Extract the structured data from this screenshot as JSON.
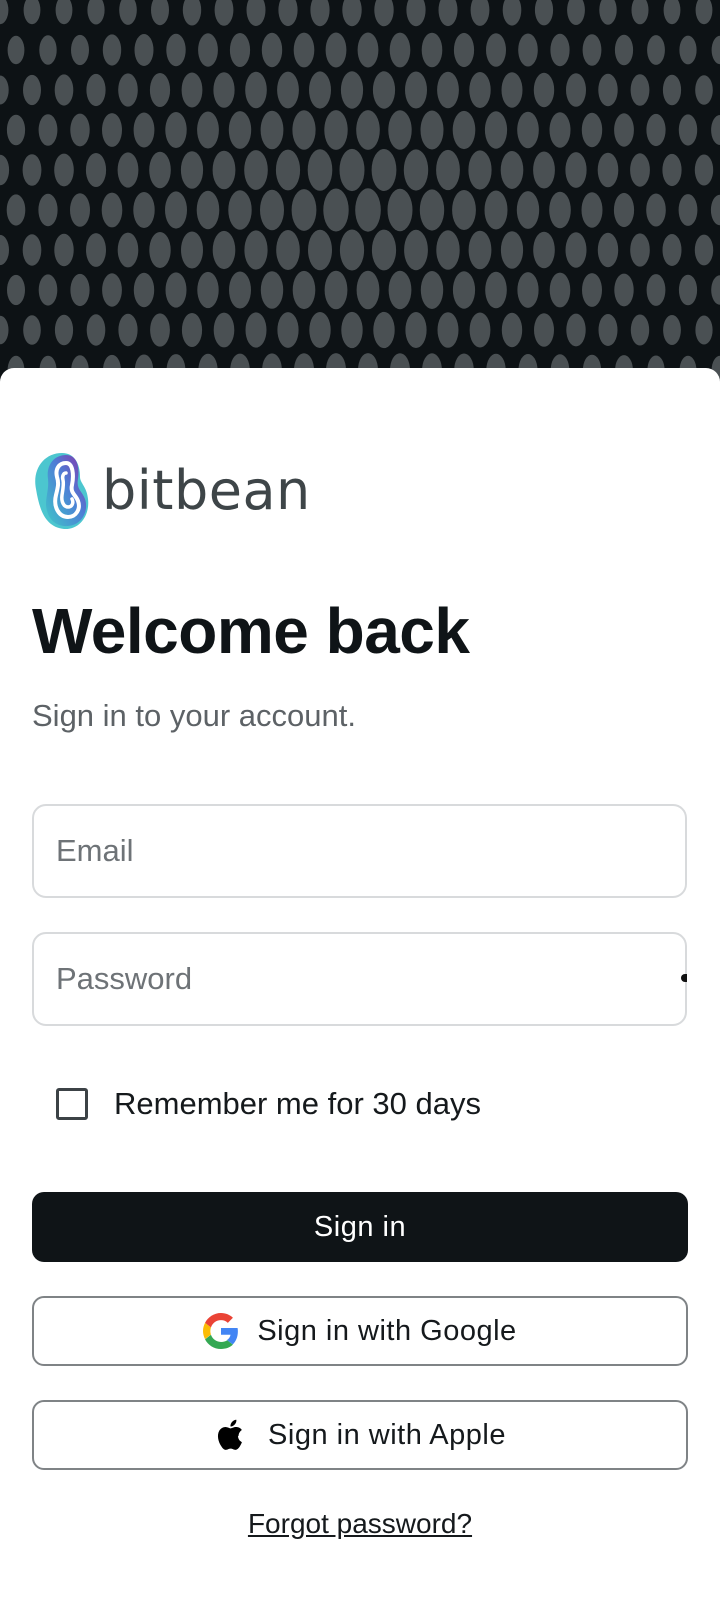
{
  "brand": {
    "name": "bitbean",
    "logo_icon": "bitbean-logo-icon"
  },
  "header": {
    "title": "Welcome back",
    "subtitle": "Sign in to your account."
  },
  "form": {
    "email": {
      "placeholder": "Email",
      "value": ""
    },
    "password": {
      "placeholder": "Password",
      "value": ""
    },
    "remember": {
      "label": "Remember me for 30 days",
      "checked": false
    }
  },
  "actions": {
    "sign_in": "Sign in",
    "google": {
      "label": "Sign in with Google",
      "icon": "google-icon"
    },
    "apple": {
      "label": "Sign in with Apple",
      "icon": "apple-icon"
    },
    "forgot": "Forgot password?"
  },
  "colors": {
    "hero_background": "#0d1215",
    "primary_button": "#0f1417",
    "text": "#0f1417",
    "muted_text": "#5d6266",
    "input_border": "#d8dadc"
  }
}
